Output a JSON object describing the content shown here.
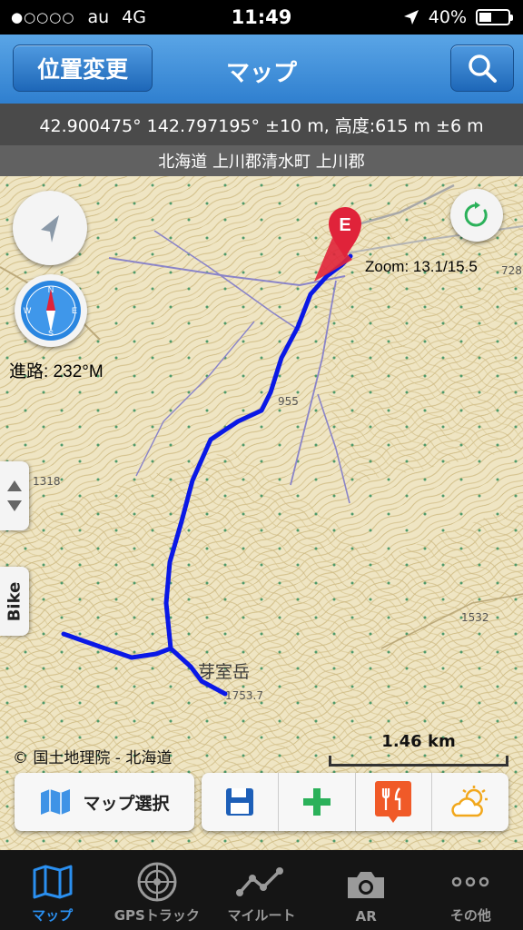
{
  "status_bar": {
    "carrier": "au",
    "network": "4G",
    "time": "11:49",
    "battery": "40%",
    "battery_level": 0.4,
    "signal_dots": "●○○○○"
  },
  "nav": {
    "left_button": "位置変更",
    "title": "マップ",
    "right_icon": "search-icon"
  },
  "info": {
    "coordinates": "42.900475° 142.797195° ±10 m, 高度:615 m ±6 m",
    "address": "北海道 上川郡清水町 上川郡"
  },
  "map": {
    "heading": "進路: 232°M",
    "zoom": "Zoom: 13.1/15.5",
    "marker_label": "E",
    "side_tab_label": "Bike",
    "copyright": "© 国土地理院 - 北海道",
    "scale": "1.46 km",
    "map_labels": {
      "peak": "芽室岳",
      "elev_a": "1753.7",
      "elev_b": "1318",
      "elev_c": "1532",
      "elev_d": "955",
      "elev_e": "728"
    },
    "track_color": "#0a18e6"
  },
  "toolbar": {
    "map_select": "マップ選択",
    "actions": [
      "save-icon",
      "add-icon",
      "restaurant-icon",
      "weather-icon"
    ]
  },
  "tabs": [
    {
      "label": "マップ",
      "icon": "map-icon",
      "active": true
    },
    {
      "label": "GPSトラック",
      "icon": "radar-icon",
      "active": false
    },
    {
      "label": "マイルート",
      "icon": "route-icon",
      "active": false
    },
    {
      "label": "AR",
      "icon": "camera-icon",
      "active": false
    },
    {
      "label": "その他",
      "icon": "more-icon",
      "active": false
    }
  ]
}
